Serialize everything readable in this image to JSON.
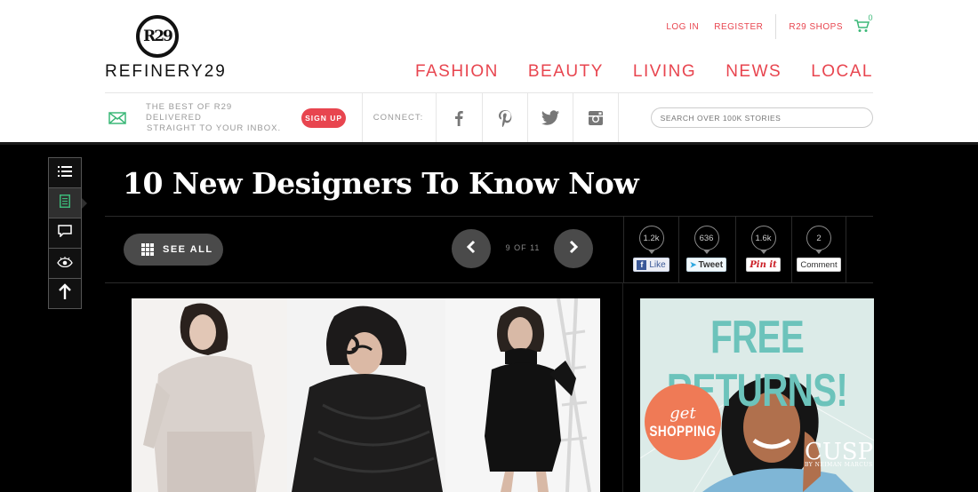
{
  "brand": {
    "logo_mark": "R29",
    "wordmark": "REFINERY29"
  },
  "top_links": {
    "login": "LOG IN",
    "register": "REGISTER",
    "shops": "R29 SHOPS",
    "cart_count": "0"
  },
  "nav": [
    "FASHION",
    "BEAUTY",
    "LIVING",
    "NEWS",
    "LOCAL"
  ],
  "subbar": {
    "newsletter_line1": "THE BEST OF R29 DELIVERED",
    "newsletter_line2": "STRAIGHT TO YOUR INBOX.",
    "signup": "SIGN UP",
    "connect": "CONNECT:",
    "social_icons": [
      "facebook-icon",
      "pinterest-icon",
      "twitter-icon",
      "instagram-icon"
    ],
    "search_placeholder": "SEARCH OVER 100K STORIES"
  },
  "rail_icons": [
    "list-icon",
    "article-icon",
    "comment-icon",
    "eye-icon",
    "arrow-up-icon"
  ],
  "article": {
    "title": "10 New Designers To Know Now",
    "see_all": "SEE ALL",
    "pager": "9 OF 11"
  },
  "share": [
    {
      "count": "1.2k",
      "label": "Like"
    },
    {
      "count": "636",
      "label": "Tweet"
    },
    {
      "count": "1.6k",
      "label": "Pin it"
    },
    {
      "count": "2",
      "label": "Comment"
    }
  ],
  "ad": {
    "headline": "FREE RETURNS!",
    "circle_top": "get",
    "circle_bottom": "SHOPPING",
    "brand": "CUSP",
    "brand_sub": "BY NEIMAN MARCUS"
  },
  "colors": {
    "accent": "#e8454f",
    "green": "#3cb878",
    "ad_teal": "#6cc3bb",
    "ad_orange": "#ef7a56"
  }
}
